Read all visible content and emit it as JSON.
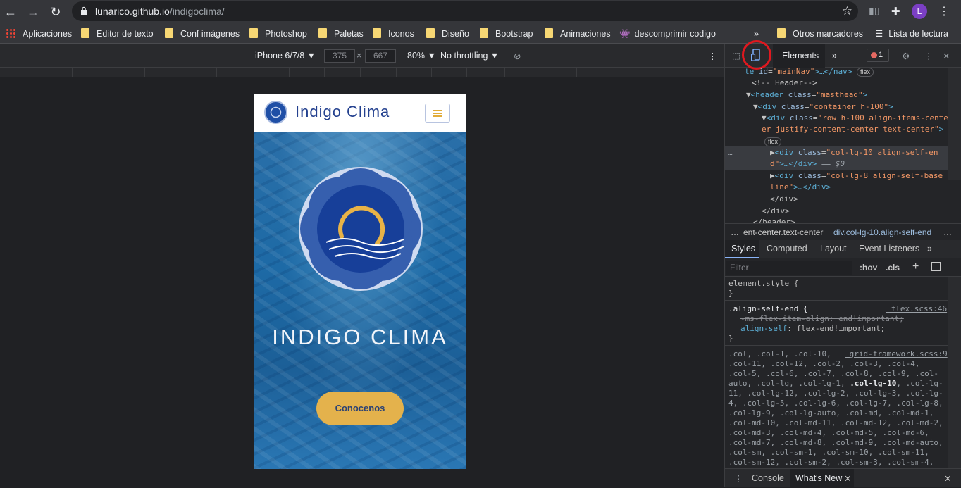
{
  "browser": {
    "url_host": "lunarico.github.io",
    "url_path": "/indigoclima/",
    "avatar_letter": "L"
  },
  "bookmarks": [
    {
      "label": "Aplicaciones",
      "icon": "apps-grid-icon"
    },
    {
      "label": "Editor de texto",
      "icon": "folder-icon"
    },
    {
      "label": "Conf imágenes",
      "icon": "folder-icon"
    },
    {
      "label": "Photoshop",
      "icon": "folder-icon"
    },
    {
      "label": "Paletas",
      "icon": "folder-icon"
    },
    {
      "label": "Iconos",
      "icon": "folder-icon"
    },
    {
      "label": "Diseño",
      "icon": "folder-icon"
    },
    {
      "label": "Bootstrap",
      "icon": "folder-icon"
    },
    {
      "label": "Animaciones",
      "icon": "folder-icon"
    },
    {
      "label": "descomprimir codigo",
      "icon": "alien-icon"
    }
  ],
  "bookmarks_right": {
    "overflow": "»",
    "other": "Otros marcadores",
    "reading_list": "Lista de lectura"
  },
  "device_toolbar": {
    "device": "iPhone 6/7/8 ▼",
    "width": "375",
    "times": "×",
    "height": "667",
    "zoom": "80% ▼",
    "throttling": "No throttling ▼"
  },
  "site": {
    "brand": "Indigo Clima",
    "hero_title": "INDIGO CLIMA",
    "cta": "Conocenos"
  },
  "devtools": {
    "tab_elements": "Elements",
    "tab_more": "»",
    "error_count": "1",
    "breadcrumb_1": "ent-center.text-center",
    "breadcrumb_2": "div.col-lg-10.align-self-end",
    "breadcrumb_more": "…",
    "subtabs": [
      "Styles",
      "Computed",
      "Layout",
      "Event Listeners",
      "»"
    ],
    "filter_placeholder": "Filter",
    "hov": ":hov",
    "cls": ".cls",
    "bottom_console": "Console",
    "bottom_whatsnew": "What's New",
    "bottom_close": "✕"
  },
  "code": {
    "l1a": "te",
    "l1b": "id",
    "l1c": "\"mainNav\"",
    "l1d": ">…</nav>",
    "l1chip": "flex",
    "l2": "<!-- Header-->",
    "l3a": "▼",
    "l3b": "<header",
    "l3c": "class",
    "l3d": "\"masthead\"",
    "l3e": ">",
    "l4a": "▼",
    "l4b": "<div",
    "l4c": "class",
    "l4d": "\"container h-100\"",
    "l4e": ">",
    "l5a": "▼",
    "l5b": "<div",
    "l5c": "class",
    "l5d": "\"row h-100 align-items-center",
    "l5e": "er justify-content-center text-center\"",
    "l5f": ">",
    "l6chip": "flex",
    "l7a": "▶",
    "l7b": "<div",
    "l7c": "class",
    "l7d": "\"col-lg-10 align-self-en",
    "l7e": "d\"",
    "l7f": ">…</div>",
    "l7g": " == $0",
    "l8a": "▶",
    "l8b": "<div",
    "l8c": "class",
    "l8d": "\"col-lg-8 align-self-base",
    "l8e": "line\"",
    "l8f": ">…</div>",
    "l9": "</div>",
    "l10": "</div>",
    "l11": "</header>",
    "dots": "…"
  },
  "styles": {
    "s1": "element.style {",
    "s2": "}",
    "s3": ".align-self-end {",
    "s3src": "_flex.scss:46",
    "s4": "-ms-flex-item-align: end!important;",
    "s5a": "align-self",
    "s5b": ": flex-end!important;",
    "s6": "}",
    "s7": ".col, .col-1, .col-10,",
    "s7src": "_grid-framework.scss:9",
    "s8": ".col-11, .col-12, .col-2, .col-3, .col-4,",
    "s9": ".col-5, .col-6, .col-7, .col-8, .col-9, .col-",
    "s10a": "auto, .col-lg, .col-lg-1, ",
    "s10b": ".col-lg-10",
    "s10c": ", .col-lg-",
    "s11": "11, .col-lg-12, .col-lg-2, .col-lg-3, .col-lg-",
    "s12": "4, .col-lg-5, .col-lg-6, .col-lg-7, .col-lg-8,",
    "s13": ".col-lg-9, .col-lg-auto, .col-md, .col-md-1,",
    "s14": ".col-md-10, .col-md-11, .col-md-12, .col-md-2,",
    "s15": ".col-md-3, .col-md-4, .col-md-5, .col-md-6,",
    "s16": ".col-md-7, .col-md-8, .col-md-9, .col-md-auto,",
    "s17": ".col-sm, .col-sm-1, .col-sm-10, .col-sm-11,",
    "s18": ".col-sm-12, .col-sm-2, .col-sm-3, .col-sm-4,"
  },
  "colors": {
    "accent_red_circle": "#e0181f",
    "brand_blue": "#24418f",
    "cta_gold": "#e4b24c"
  }
}
